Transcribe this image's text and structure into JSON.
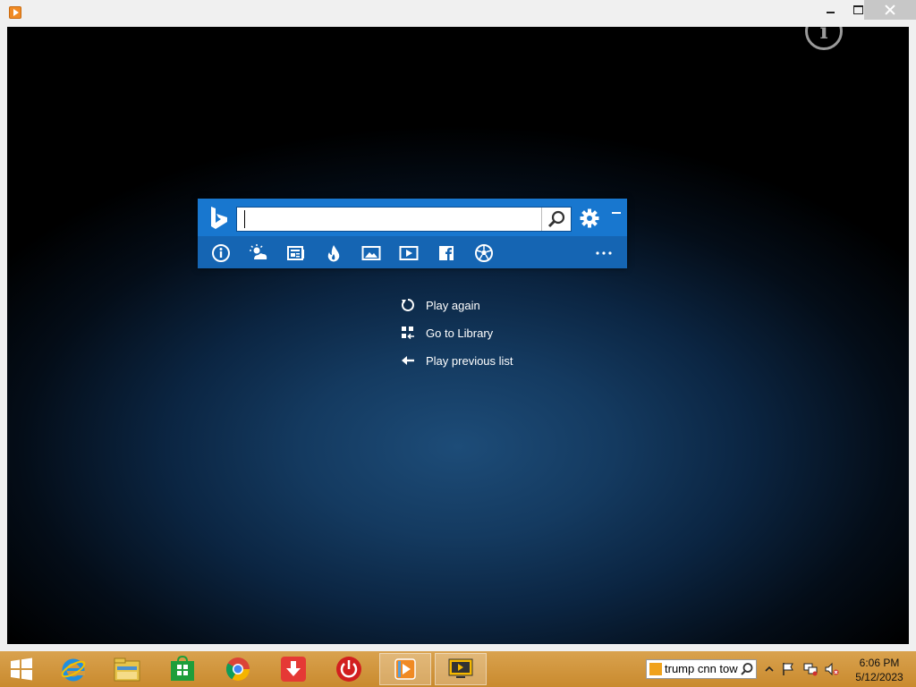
{
  "window": {
    "app_icon": "media-player-icon",
    "controls": [
      "minimize",
      "maximize",
      "close"
    ]
  },
  "player": {
    "info_button_glyph": "i",
    "menu": [
      {
        "label": "Play again",
        "icon": "replay-icon"
      },
      {
        "label": "Go to Library",
        "icon": "library-icon"
      },
      {
        "label": "Play previous list",
        "icon": "back-arrow-icon"
      }
    ]
  },
  "bing_bar": {
    "search_value": "",
    "categories": [
      {
        "name": "info",
        "icon": "info-icon"
      },
      {
        "name": "weather",
        "icon": "weather-icon"
      },
      {
        "name": "news",
        "icon": "news-icon"
      },
      {
        "name": "trending",
        "icon": "flame-icon"
      },
      {
        "name": "images",
        "icon": "image-icon"
      },
      {
        "name": "videos",
        "icon": "video-icon"
      },
      {
        "name": "facebook",
        "icon": "facebook-icon"
      },
      {
        "name": "sports",
        "icon": "soccer-ball-icon"
      },
      {
        "name": "more",
        "icon": "more-icon"
      }
    ],
    "accent_color": "#1877cf"
  },
  "taskbar": {
    "apps": [
      "windows-start",
      "internet-explorer",
      "file-explorer",
      "store",
      "chrome",
      "download-manager",
      "power-app",
      "media-player",
      "bing-app"
    ],
    "search_text": "trump cnn tow",
    "clock_time": "6:06 PM",
    "clock_date": "5/12/2023",
    "color": "#d19a40"
  }
}
